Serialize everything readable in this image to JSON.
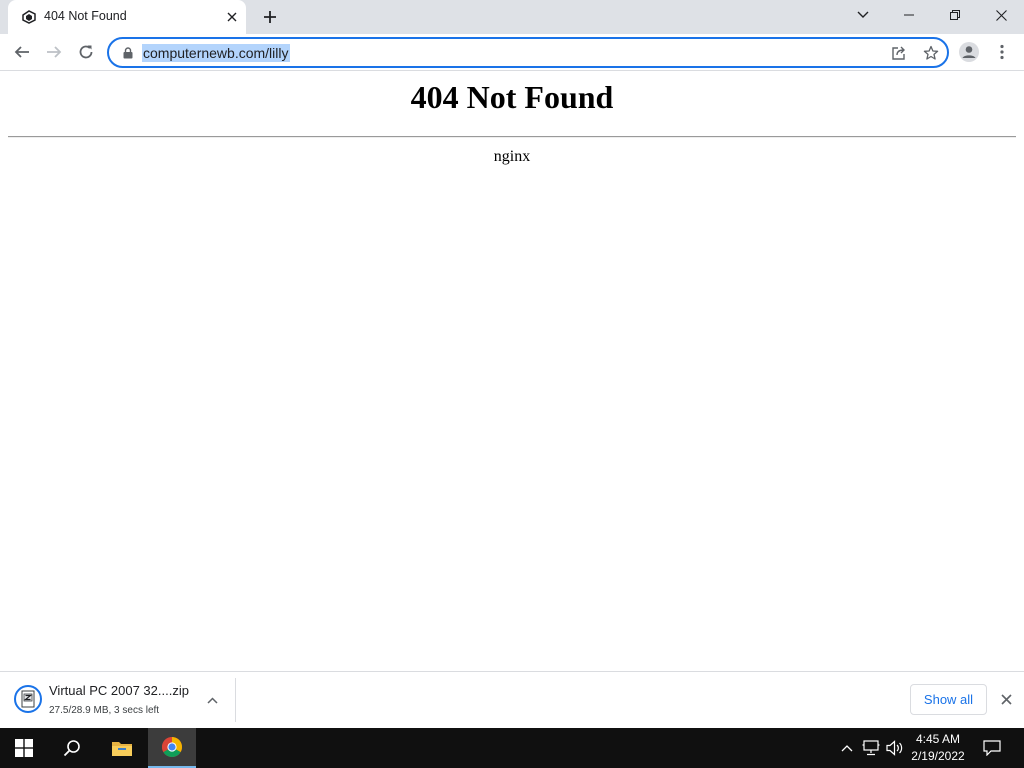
{
  "browser": {
    "tab": {
      "title": "404 Not Found",
      "favicon": "page-favicon"
    },
    "address_bar": {
      "url": "computernewb.com/lilly",
      "secure_icon": "lock-icon"
    },
    "toolbar_icons": [
      "back-icon",
      "forward-icon",
      "reload-icon",
      "share-icon",
      "star-icon",
      "profile-icon",
      "menu-icon"
    ],
    "window_controls": [
      "tab-search-icon",
      "minimize-icon",
      "restore-icon",
      "close-icon"
    ]
  },
  "page": {
    "heading": "404 Not Found",
    "server": "nginx"
  },
  "download_shelf": {
    "item": {
      "name": "Virtual PC 2007 32....zip",
      "status": "27.5/28.9 MB, 3 secs left",
      "icon": "zip-file-icon"
    },
    "show_all_label": "Show all"
  },
  "taskbar": {
    "apps": [
      "windows-start-icon",
      "search-icon",
      "file-explorer-icon",
      "chrome-icon"
    ],
    "tray_icons": [
      "show-hidden-icon",
      "network-icon",
      "volume-icon",
      "notification-icon"
    ],
    "time": "4:45 AM",
    "date": "2/19/2022"
  },
  "colors": {
    "accent": "#1a73e8",
    "tabstrip": "#dee1e6",
    "taskbar": "#101010",
    "selection": "#b3d4fc"
  }
}
